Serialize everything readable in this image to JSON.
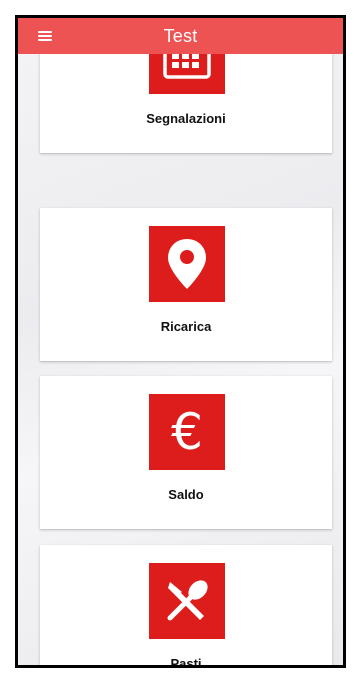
{
  "appbar": {
    "title": "Test",
    "menu_icon": "hamburger-menu-icon",
    "color": "#ee5353"
  },
  "cards": [
    {
      "label": "Segnalazioni",
      "icon": "calendar-icon"
    },
    {
      "label": "Ricarica",
      "icon": "map-pin-icon"
    },
    {
      "label": "Saldo",
      "icon": "euro-icon",
      "glyph": "€"
    },
    {
      "label": "Pasti",
      "icon": "spoon-knife-icon"
    }
  ],
  "accent": "#dd1c1c"
}
